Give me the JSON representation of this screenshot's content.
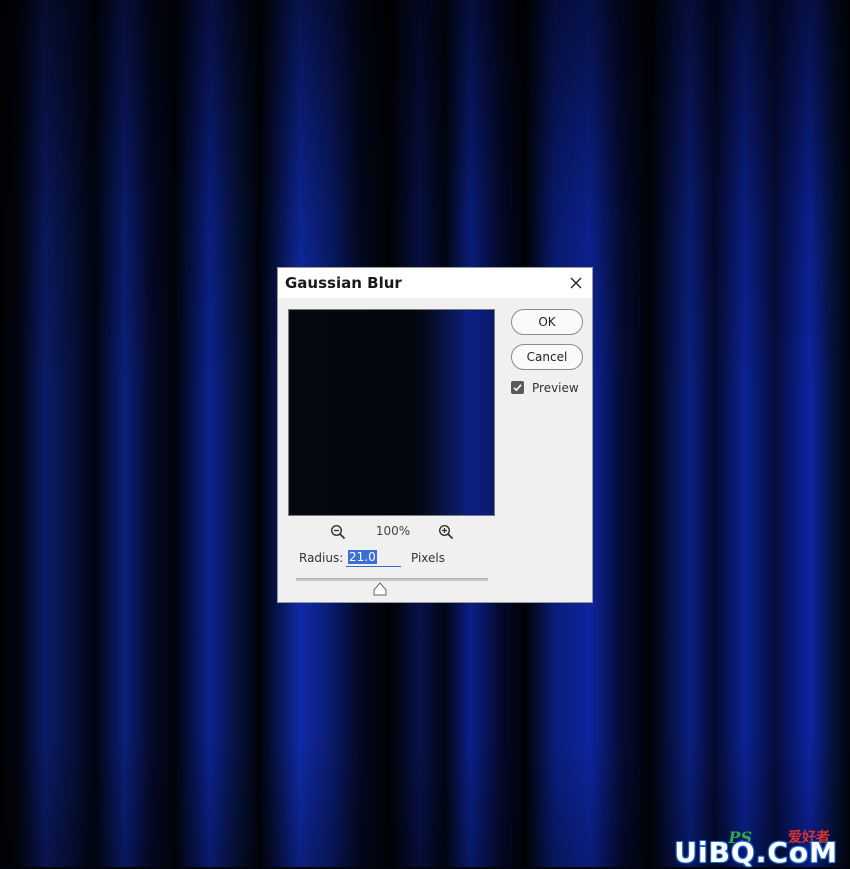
{
  "dialog": {
    "title": "Gaussian Blur",
    "ok_label": "OK",
    "cancel_label": "Cancel",
    "preview_label": "Preview",
    "preview_checked": true,
    "zoom_level": "100%",
    "radius_label": "Radius:",
    "radius_value": "21.0",
    "unit_label": "Pixels",
    "slider_position_fraction": 0.44
  },
  "watermark": {
    "ps_text": "PS",
    "cn_text": "爱好者",
    "main_text": "UiBQ.CoM"
  },
  "colors": {
    "curtain_blue": "#0f2aa8",
    "selection_blue": "#3b6fd6",
    "dialog_bg": "#f0f0f0"
  }
}
